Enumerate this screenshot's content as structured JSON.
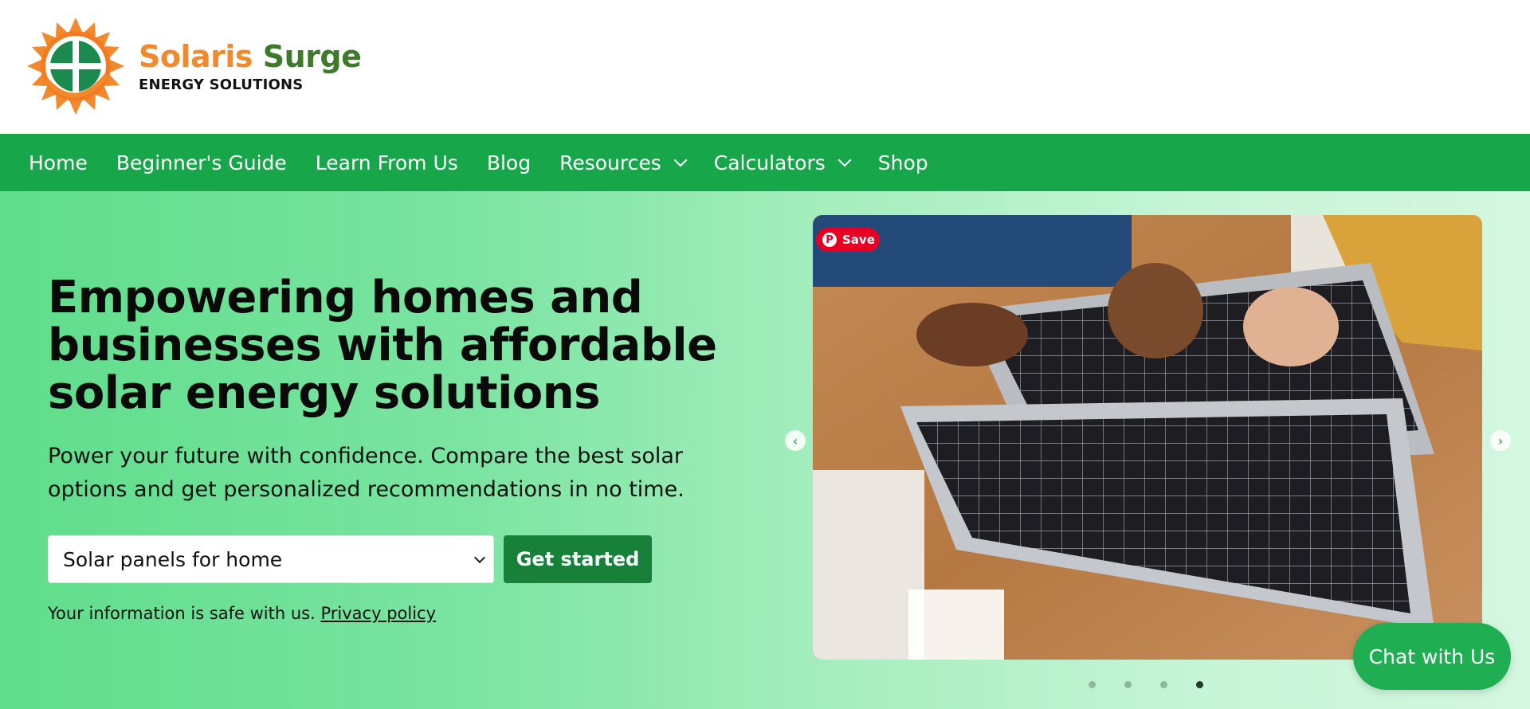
{
  "brand": {
    "name_part1": "Solaris",
    "name_part2": "Surge",
    "tagline": "ENERGY SOLUTIONS",
    "logo_icon": "sun-cross-icon"
  },
  "nav": {
    "items": [
      {
        "label": "Home",
        "has_dropdown": false
      },
      {
        "label": "Beginner's Guide",
        "has_dropdown": false
      },
      {
        "label": "Learn From Us",
        "has_dropdown": false
      },
      {
        "label": "Blog",
        "has_dropdown": false
      },
      {
        "label": "Resources",
        "has_dropdown": true
      },
      {
        "label": "Calculators",
        "has_dropdown": true
      },
      {
        "label": "Shop",
        "has_dropdown": false
      }
    ]
  },
  "hero": {
    "headline": "Empowering homes and businesses with affordable solar energy solutions",
    "subtext": "Power your future with confidence. Compare the best solar options and get personalized recommendations in no time.",
    "select": {
      "selected": "Solar panels for home"
    },
    "cta_label": "Get started",
    "privacy_text": "Your information is safe with us.",
    "privacy_link": "Privacy policy"
  },
  "carousel": {
    "save_label": "Save",
    "slide_count": 4,
    "active_slide": 4
  },
  "chat": {
    "label": "Chat with Us"
  },
  "colors": {
    "nav_bg": "#17a74a",
    "cta_bg": "#178039",
    "brand_orange": "#f08a2c",
    "brand_green": "#3d7a2a",
    "pinterest_red": "#e60023"
  }
}
